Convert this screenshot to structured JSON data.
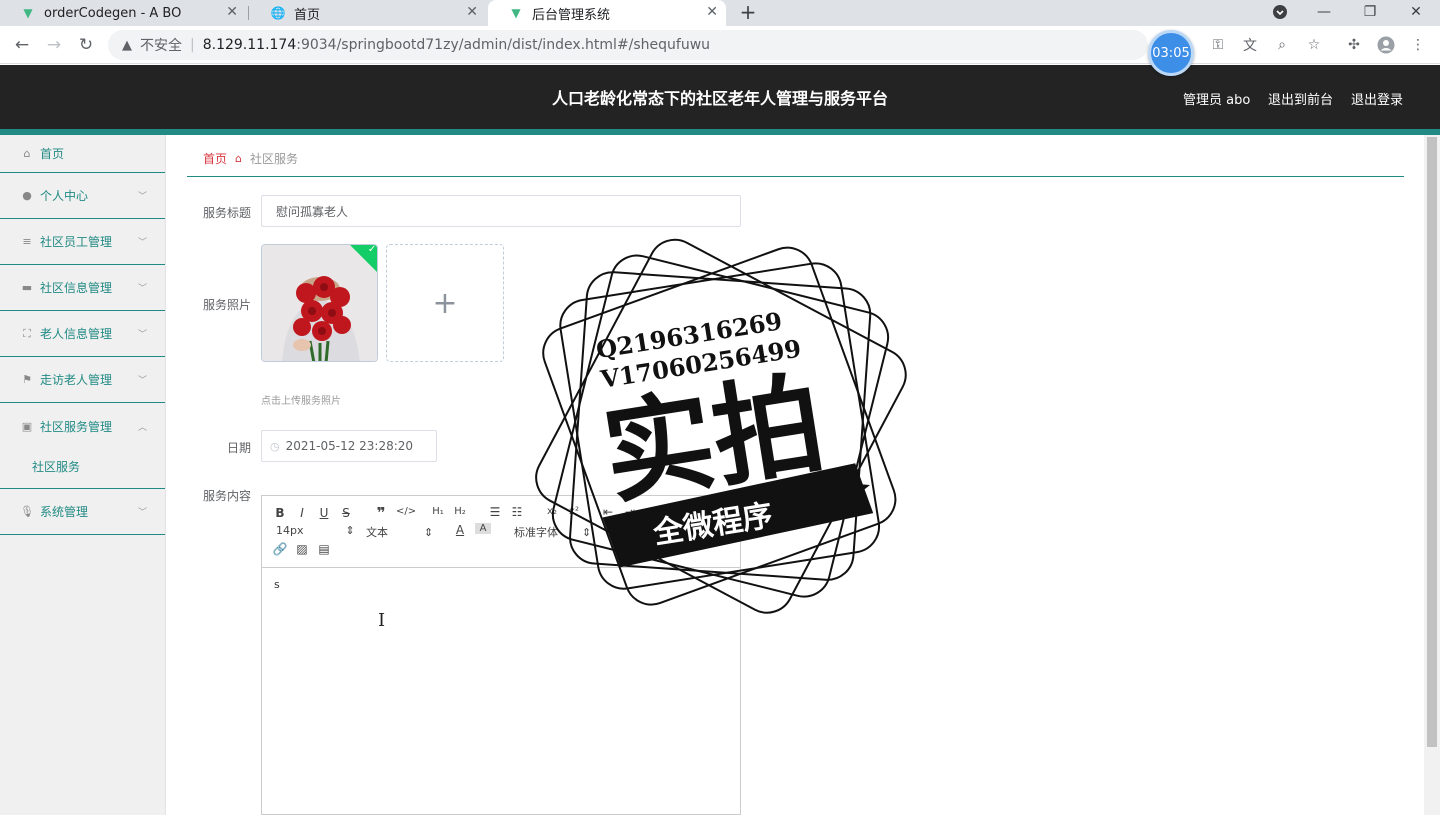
{
  "browser": {
    "tabs": [
      {
        "title": "orderCodegen - A BO",
        "icon": "vue-logo-icon"
      },
      {
        "title": "首页",
        "icon": "globe-icon"
      },
      {
        "title": "后台管理系统",
        "icon": "vue-logo-icon",
        "active": true
      }
    ],
    "url": {
      "insecure_label": "不安全",
      "host": "8.129.11.174",
      "path": ":9034/springbootd71zy/admin/dist/index.html#/shequfuwu"
    },
    "timer": "03:05"
  },
  "header": {
    "title": "人口老龄化常态下的社区老年人管理与服务平台",
    "user": "管理员 abo",
    "to_front": "退出到前台",
    "logout": "退出登录"
  },
  "sidebar": {
    "items": [
      {
        "label": "首页",
        "icon": "home-icon"
      },
      {
        "label": "个人中心",
        "icon": "user-icon"
      },
      {
        "label": "社区员工管理",
        "icon": "list-icon"
      },
      {
        "label": "社区信息管理",
        "icon": "briefcase-icon"
      },
      {
        "label": "老人信息管理",
        "icon": "fullscreen-icon"
      },
      {
        "label": "走访老人管理",
        "icon": "flag-icon"
      },
      {
        "label": "社区服务管理",
        "icon": "trash-icon"
      },
      {
        "label": "社区服务",
        "icon": ""
      },
      {
        "label": "系统管理",
        "icon": "mic-icon"
      }
    ]
  },
  "breadcrumb": {
    "home": "首页",
    "current": "社区服务"
  },
  "form": {
    "title_label": "服务标题",
    "title_value": "慰问孤寡老人",
    "photo_label": "服务照片",
    "photo_hint": "点击上传服务照片",
    "date_label": "日期",
    "date_value": "2021-05-12 23:28:20",
    "content_label": "服务内容",
    "content_text": "s"
  },
  "editor": {
    "font_size": "14px",
    "block_type": "文本",
    "font_family": "标准字体"
  },
  "watermark": {
    "line1": "Q2196316269",
    "line2": "V17060256499",
    "main": "实拍",
    "banner": "全微程序"
  },
  "colors": {
    "accent": "#218a84",
    "header_bg": "#232323",
    "breadcrumb_home": "#d9363e"
  }
}
